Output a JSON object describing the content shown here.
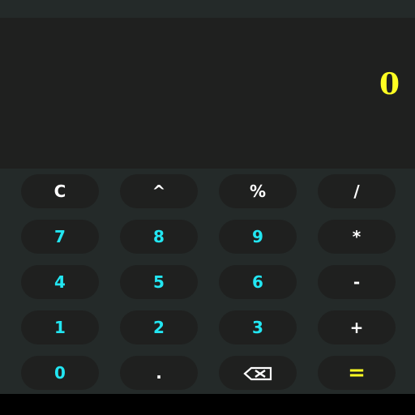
{
  "colors": {
    "background": "#242a29",
    "display_background": "#1f201f",
    "key_background": "#1f201f",
    "display_text": "#ffff22",
    "number_text": "#22e6f2",
    "operator_text": "#ffffff",
    "equals_text": "#ffff22"
  },
  "display": {
    "value": "0"
  },
  "keys": {
    "clear": "C",
    "power": "^",
    "percent": "%",
    "divide": "/",
    "seven": "7",
    "eight": "8",
    "nine": "9",
    "multiply": "*",
    "four": "4",
    "five": "5",
    "six": "6",
    "subtract": "-",
    "one": "1",
    "two": "2",
    "three": "3",
    "add": "+",
    "zero": "0",
    "decimal": ".",
    "backspace_icon": "backspace-icon",
    "equals": "="
  }
}
